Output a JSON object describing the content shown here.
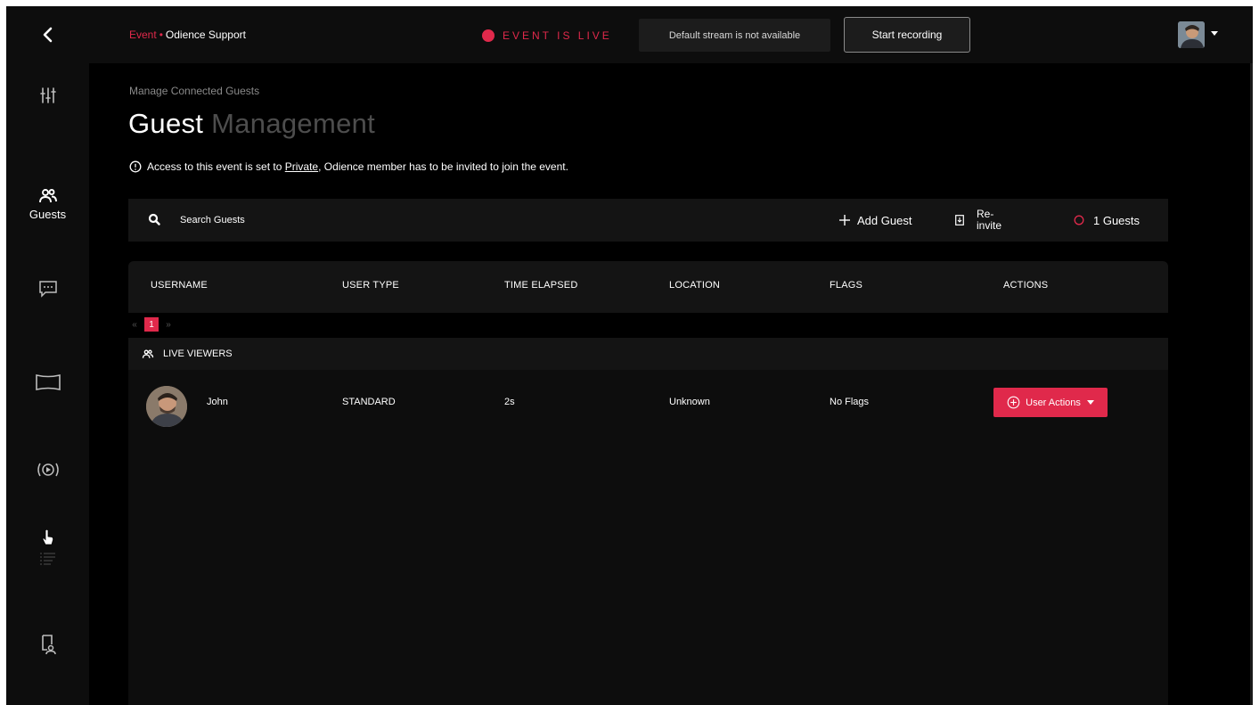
{
  "colors": {
    "accent": "#e0294b",
    "background": "#000000",
    "panel": "#141414",
    "sidebar": "#0d0d0d",
    "muted_text": "#8a8a8a"
  },
  "topbar": {
    "breadcrumb_event": "Event",
    "breadcrumb_separator": "•",
    "breadcrumb_page": "Odience Support",
    "live_status": "EVENT IS LIVE",
    "stream_status": "Default stream is not available",
    "record_label": "Start recording",
    "icons": {
      "back": "chevron-left-icon",
      "avatar_menu": "caret-down-icon"
    }
  },
  "sidebar": {
    "items": [
      {
        "id": "controls",
        "icon": "sliders-icon",
        "label": ""
      },
      {
        "id": "guests",
        "icon": "users-icon",
        "label": "Guests",
        "active": true
      },
      {
        "id": "chat",
        "icon": "chat-icon",
        "label": ""
      },
      {
        "id": "screens",
        "icon": "screen-icon",
        "label": ""
      },
      {
        "id": "broadcast",
        "icon": "broadcast-icon",
        "label": ""
      },
      {
        "id": "list",
        "icon": "list-icon",
        "label": ""
      },
      {
        "id": "device",
        "icon": "device-icon",
        "label": ""
      }
    ]
  },
  "header": {
    "subtitle": "Manage Connected Guests",
    "title_primary": "Guest",
    "title_secondary": "Management",
    "notice_before": "Access to this event is set to",
    "notice_link": "Private",
    "notice_after": ", Odience member has to be invited to join the event."
  },
  "toolbar": {
    "search_placeholder": "Search Guests",
    "add_guest_label": "Add Guest",
    "reinvite_label": "Re-invite",
    "guest_count": "1 Guests"
  },
  "table": {
    "columns": [
      "USERNAME",
      "USER TYPE",
      "TIME ELAPSED",
      "LOCATION",
      "FLAGS",
      "ACTIONS"
    ],
    "pager": {
      "prev": "«",
      "current": "1",
      "next": "»"
    },
    "group_label": "LIVE VIEWERS",
    "rows": [
      {
        "username": "John",
        "user_type": "STANDARD",
        "time_elapsed": "2s",
        "location": "Unknown",
        "flags": "No Flags",
        "action_label": "User Actions"
      }
    ]
  }
}
